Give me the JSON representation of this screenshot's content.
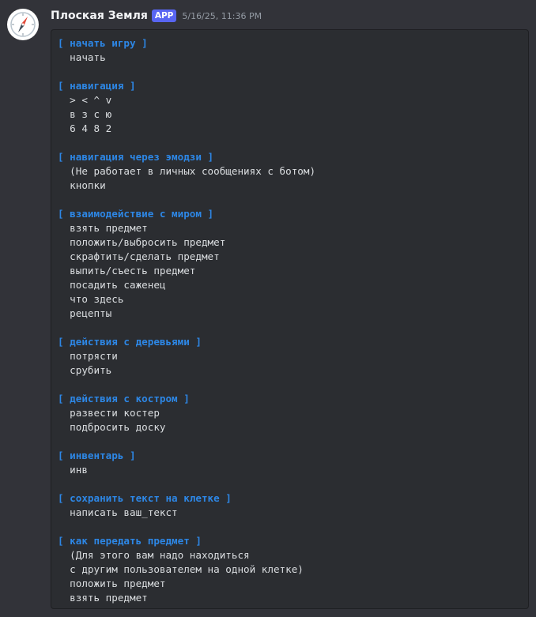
{
  "message": {
    "avatar_icon": "compass-icon",
    "username": "Плоская Земля",
    "badge": "APP",
    "timestamp": "5/16/25, 11:36 PM"
  },
  "colors": {
    "background": "#323339",
    "codeblock_bg": "#2b2d31",
    "section_title": "#2d87e6",
    "text": "#dbdee1",
    "badge_bg": "#5865f2"
  },
  "sections": [
    {
      "title": "[ начать игру ]",
      "lines": [
        "  начать"
      ]
    },
    {
      "title": "[ навигация ]",
      "lines": [
        "  > < ^ v",
        "  в з с ю",
        "  6 4 8 2"
      ]
    },
    {
      "title": "[ навигация через эмодзи ]",
      "lines": [
        "  (Не работает в личных сообщениях с ботом)",
        "  кнопки"
      ]
    },
    {
      "title": "[ взаимодействие с миром ]",
      "lines": [
        "  взять предмет",
        "  положить/выбросить предмет",
        "  скрафтить/сделать предмет",
        "  выпить/съесть предмет",
        "  посадить саженец",
        "  что здесь",
        "  рецепты"
      ]
    },
    {
      "title": "[ действия с деревьями ]",
      "lines": [
        "  потрясти",
        "  срубить"
      ]
    },
    {
      "title": "[ действия с костром ]",
      "lines": [
        "  развести костер",
        "  подбросить доску"
      ]
    },
    {
      "title": "[ инвентарь ]",
      "lines": [
        "  инв"
      ]
    },
    {
      "title": "[ сохранить текст на клетке ]",
      "lines": [
        "  написать ваш_текст"
      ]
    },
    {
      "title": "[ как передать предмет ]",
      "lines": [
        "  (Для этого вам надо находиться",
        "  с другим пользователем на одной клетке)",
        "  положить предмет",
        "  взять предмет"
      ]
    }
  ]
}
